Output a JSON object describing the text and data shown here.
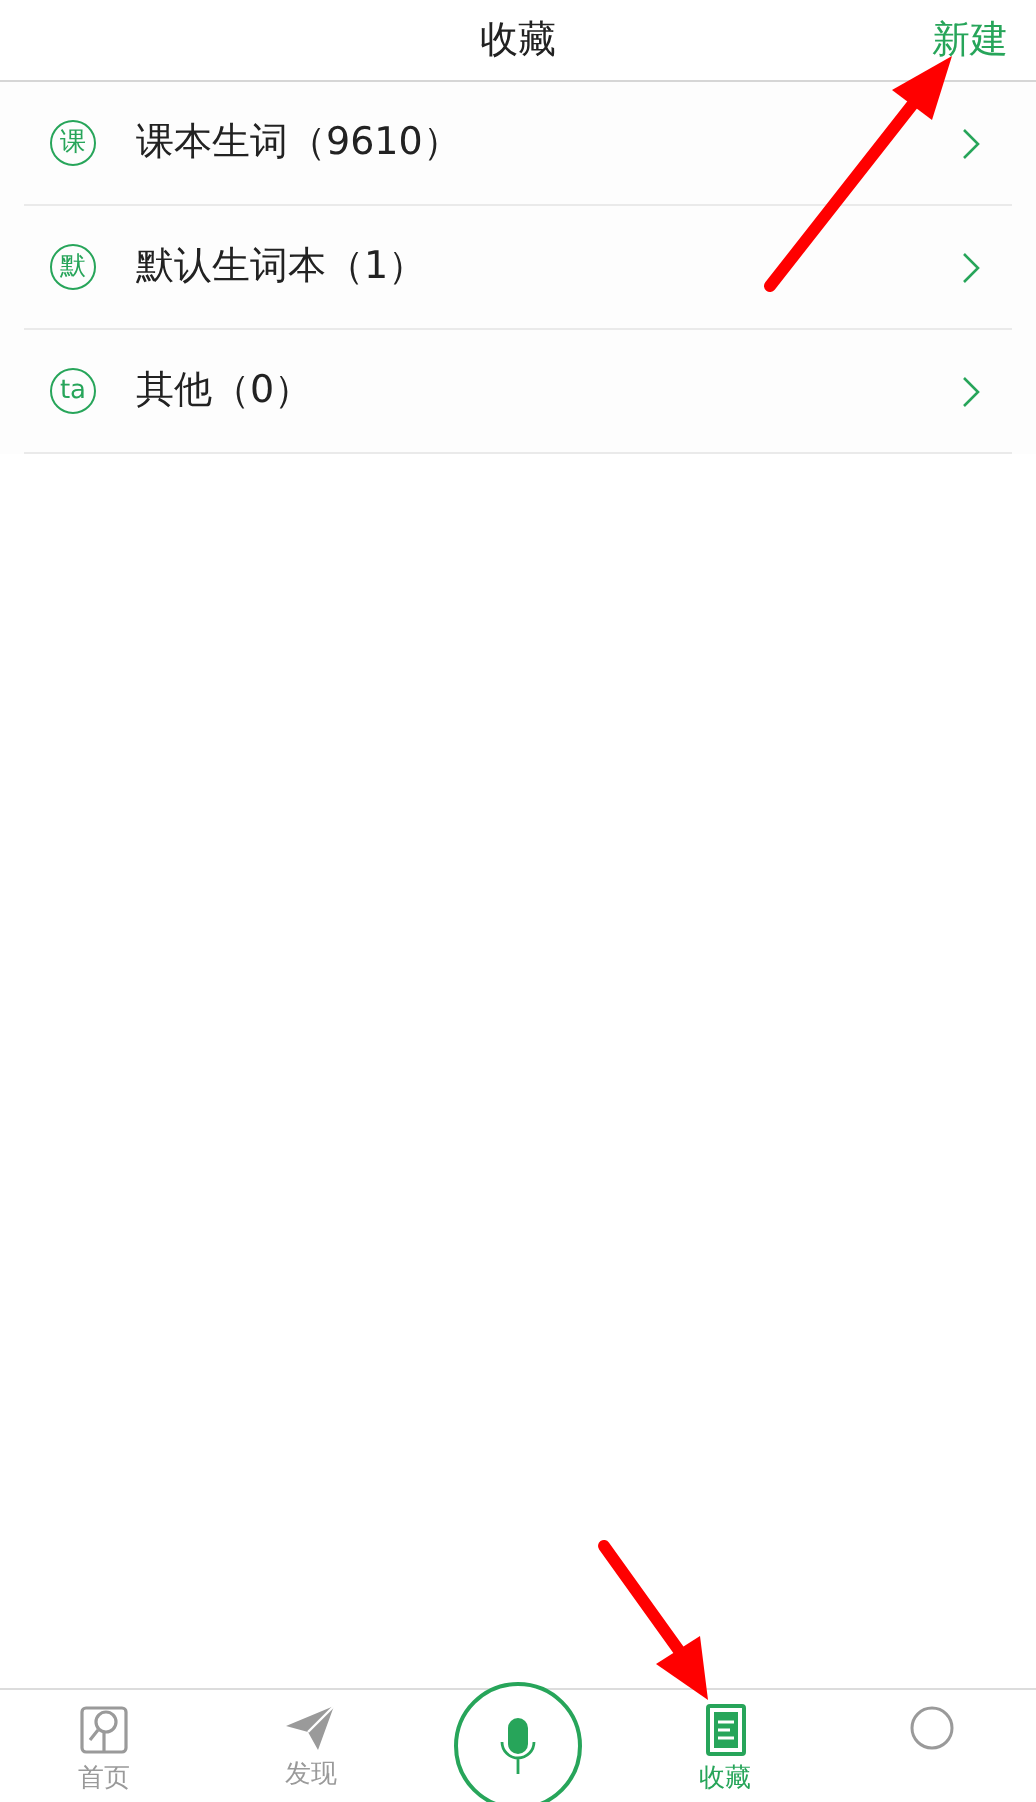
{
  "header": {
    "title": "收藏",
    "action": "新建"
  },
  "lists": [
    {
      "badge": "课",
      "name": "课本生词（9610）"
    },
    {
      "badge": "默",
      "name": "默认生词本（1）"
    },
    {
      "badge": "ta",
      "name": "其他（0）"
    }
  ],
  "tabs": [
    {
      "kind": "home",
      "label": "首页",
      "selected": false
    },
    {
      "kind": "discover",
      "label": "发现",
      "selected": false
    },
    {
      "kind": "mic",
      "selected": false
    },
    {
      "kind": "favorites",
      "label": "收藏",
      "selected": true
    },
    {
      "kind": "more",
      "selected": false
    }
  ]
}
